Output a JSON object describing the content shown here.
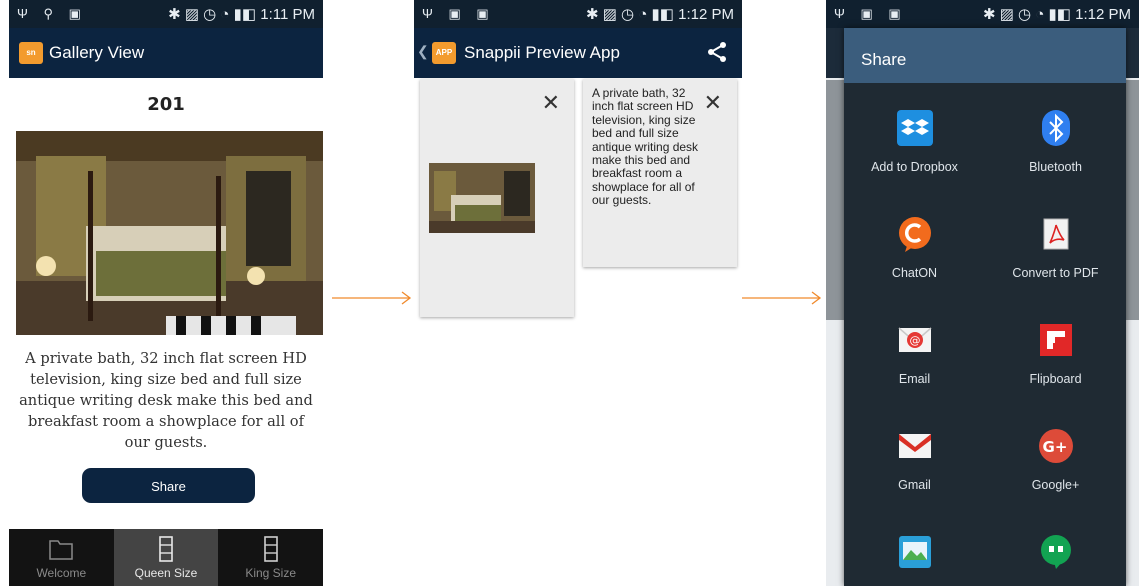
{
  "status_bars": [
    {
      "left_icons": "Ψ ⚲ ▣",
      "right_text": "✱ ▨ ◷ ◔ ▮◧ 1:11 PM"
    },
    {
      "left_icons": "Ψ ▣ ▣",
      "right_text": "✱ ▨ ◷ ◔ ▮◧ 1:12 PM"
    },
    {
      "left_icons": "Ψ ▣ ▣",
      "right_text": "✱ ▨ ◷ ◔ ▮◧ 1:12 PM"
    }
  ],
  "gallery": {
    "app_title": "Gallery View",
    "logo_text": "sn",
    "room_title": "201",
    "description": "A private bath, 32 inch flat screen HD television, king size bed and full size antique writing desk make this bed and breakfast room a showplace for all of our guests.",
    "share_label": "Share",
    "tabs": [
      {
        "label": "Welcome",
        "icon": "folder-icon"
      },
      {
        "label": "Queen Size",
        "icon": "film-icon"
      },
      {
        "label": "King Size",
        "icon": "film-icon"
      }
    ]
  },
  "preview": {
    "app_title": "Snappii Preview App",
    "logo_text": "APP",
    "back_glyph": "❮",
    "close_glyph": "✕",
    "card_text": "A private bath, 32 inch flat screen HD television, king size bed and full size antique writing desk make this bed and breakfast room a showplace for all of our guests."
  },
  "share_dialog": {
    "title": "Share",
    "apps": [
      {
        "label": "Add to Dropbox",
        "icon": "dropbox-icon"
      },
      {
        "label": "Bluetooth",
        "icon": "bluetooth-icon"
      },
      {
        "label": "ChatON",
        "icon": "chaton-icon"
      },
      {
        "label": "Convert to PDF",
        "icon": "pdf-icon"
      },
      {
        "label": "Email",
        "icon": "email-icon"
      },
      {
        "label": "Flipboard",
        "icon": "flipboard-icon"
      },
      {
        "label": "Gmail",
        "icon": "gmail-icon"
      },
      {
        "label": "Google+",
        "icon": "google-plus-icon"
      },
      {
        "label": "",
        "icon": "gallery-app-icon"
      },
      {
        "label": "",
        "icon": "hangouts-icon"
      }
    ]
  },
  "colors": {
    "appbar": "#0c2440",
    "statusbar": "#10202f",
    "arrow": "#f08a2c",
    "dialog_header": "#3b5d7d",
    "dialog_body": "#1f2a33"
  }
}
